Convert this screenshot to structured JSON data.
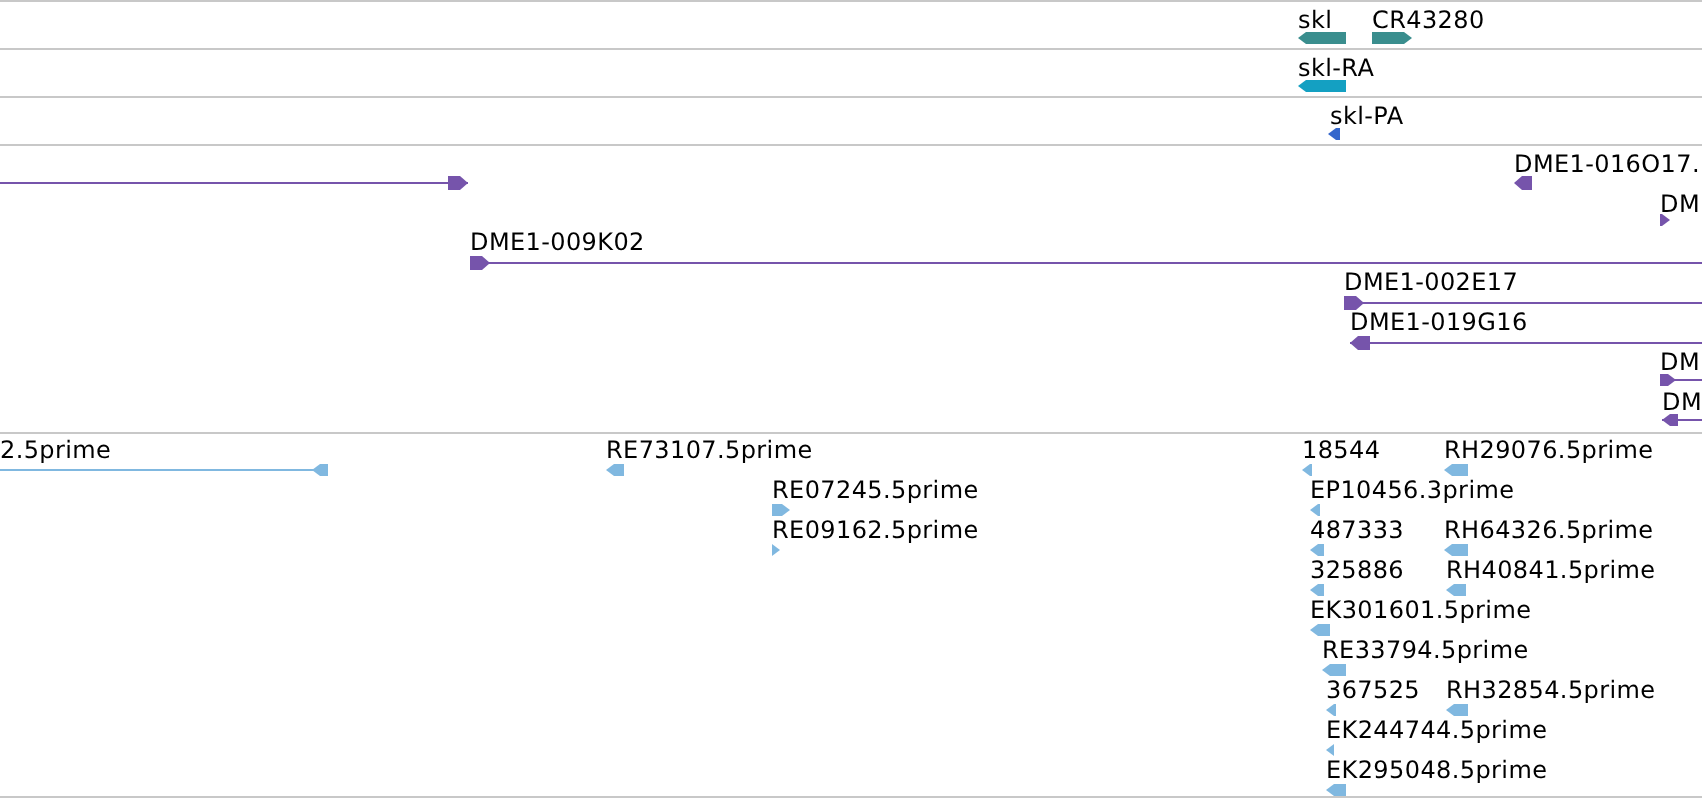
{
  "tracks": [
    {
      "color": "#3a8e8e",
      "features": [
        {
          "label": "skl",
          "reverse": true
        },
        {
          "label": "CR43280",
          "reverse": false
        }
      ]
    },
    {
      "color": "#14a0c2",
      "features": [
        {
          "label": "skl-RA",
          "reverse": true
        }
      ]
    },
    {
      "color": "#3366cc",
      "features": [
        {
          "label": "skl-PA",
          "reverse": true
        }
      ]
    },
    {
      "color": "#7654ab",
      "features": [
        {
          "reverse": false
        },
        {
          "label": "DME1-016O17.",
          "reverse": true
        },
        {
          "label": "DM",
          "reverse": false
        },
        {
          "label": "DME1-009K02",
          "reverse": false
        },
        {
          "label": "DME1-002E17",
          "reverse": false
        },
        {
          "label": "DME1-019G16",
          "reverse": true
        },
        {
          "label": "DM",
          "reverse": false
        },
        {
          "label": "DM",
          "reverse": true
        }
      ]
    },
    {
      "color": "#80b8e0",
      "features": [
        {
          "label": "2.5prime",
          "reverse": true
        },
        {
          "label": "RE73107.5prime",
          "reverse": true
        },
        {
          "label": "RE07245.5prime",
          "reverse": false
        },
        {
          "label": "RE09162.5prime",
          "reverse": false
        },
        {
          "label": "18544",
          "reverse": true
        },
        {
          "label": "RH29076.5prime",
          "reverse": true
        },
        {
          "label": "EP10456.3prime",
          "reverse": true
        },
        {
          "label": "487333",
          "reverse": true
        },
        {
          "label": "RH64326.5prime",
          "reverse": true
        },
        {
          "label": "325886",
          "reverse": true
        },
        {
          "label": "RH40841.5prime",
          "reverse": true
        },
        {
          "label": "EK301601.5prime",
          "reverse": true
        },
        {
          "label": "RE33794.5prime",
          "reverse": true
        },
        {
          "label": "367525",
          "reverse": true
        },
        {
          "label": "RH32854.5prime",
          "reverse": true
        },
        {
          "label": "EK244744.5prime",
          "reverse": true
        },
        {
          "label": "EK295048.5prime",
          "reverse": true
        }
      ]
    }
  ]
}
